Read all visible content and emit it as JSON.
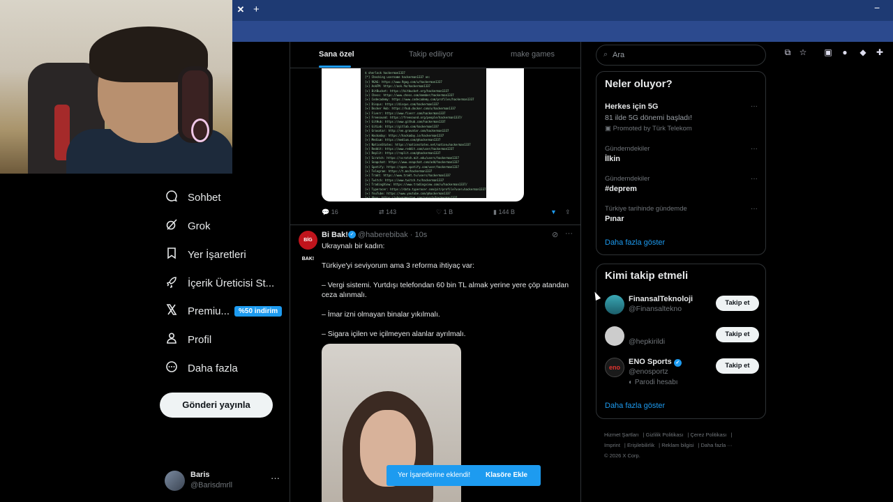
{
  "browser": {
    "close_tab": "✕",
    "new_tab": "+",
    "minimize": "−"
  },
  "sidebar": {
    "items": [
      {
        "label": "Sohbet",
        "icon": "chat-icon"
      },
      {
        "label": "Grok",
        "icon": "grok-icon"
      },
      {
        "label": "Yer İşaretleri",
        "icon": "bookmark-icon"
      },
      {
        "label": "İçerik Üreticisi St...",
        "icon": "rocket-icon"
      },
      {
        "label": "Premiu...",
        "icon": "x-logo-icon",
        "badge": "%50 indirim"
      },
      {
        "label": "Profil",
        "icon": "person-icon"
      },
      {
        "label": "Daha fazla",
        "icon": "more-circle-icon"
      }
    ],
    "post_button": "Gönderi yayınla",
    "account": {
      "name": "Baris",
      "handle": "@Barisdmrll"
    }
  },
  "feed": {
    "tabs": [
      "Sana özel",
      "Takip ediliyor",
      "make games"
    ],
    "prev_tweet_actions": {
      "replies": "16",
      "retweets": "143",
      "likes": "1 B",
      "views": "144 B"
    },
    "tweet": {
      "avatar_text": "BİG BAK!",
      "name": "Bi Bak!",
      "handle": "@haberebibak · 10s",
      "lines": [
        "Ukraynalı bir kadın:",
        "Türkiye'yi seviyorum ama 3 reforma ihtiyaç var:",
        "– Vergi sistemi. Yurtdışı telefondan 60 bin TL almak yerine yere çöp atandan ceza alınmalı.",
        "– İmar izni olmayan binalar yıkılmalı.",
        "– Sigara içilen ve içilmeyen alanlar ayrılmalı."
      ]
    }
  },
  "toast": {
    "message": "Yer İşaretlerine eklendi!",
    "action": "Klasöre Ekle"
  },
  "right": {
    "search_placeholder": "Ara",
    "trends_title": "Neler oluyor?",
    "trends": [
      {
        "context": "",
        "title": "Herkes için 5G",
        "sub": "81 ilde 5G dönemi başladı!",
        "promo": "Promoted by Türk Telekom"
      },
      {
        "context": "Gündemdekiler",
        "title": "İlkin"
      },
      {
        "context": "Gündemdekiler",
        "title": "#deprem"
      },
      {
        "context": "Türkiye tarihinde gündemde",
        "title": "Pınar"
      }
    ],
    "trends_more": "Daha fazla göster",
    "who_title": "Kimi takip etmeli",
    "who": [
      {
        "name": "FinansalTeknoloji",
        "handle": "@Finansaltekno",
        "extra": "",
        "button": "Takip et"
      },
      {
        "name": "",
        "handle": "@hepkirildi",
        "extra": "",
        "button": "Takip et"
      },
      {
        "name": "ENO Sports",
        "handle": "@enosportz",
        "extra": "Parodi hesabı",
        "button": "Takip et"
      }
    ],
    "who_more": "Daha fazla göster",
    "footer": [
      "Hizmet Şartları",
      "Gizlilik Politikası",
      "Çerez Politikası",
      "Imprint",
      "Erişilebilirlik",
      "Reklam bilgisi",
      "Daha fazla ···",
      "© 2026 X Corp."
    ]
  },
  "terminal_lines": [
    "$ sherlock hackerman1337",
    "[*] Checking username hackerman1337 on:",
    "[+] 9GAG: https://www.9gag.com/u/hackerman1337",
    "[+] AskFM: https://ask.fm/hackerman1337",
    "[+] BitBucket: https://bitbucket.org/hackerman1337",
    "[+] Chess: https://www.chess.com/member/hackerman1337",
    "[+] Codecademy: https://www.codecademy.com/profiles/hackerman1337",
    "[+] Disqus: https://disqus.com/hackerman1337",
    "[+] Docker Hub: https://hub.docker.com/u/hackerman1337",
    "[+] Fiverr: https://www.fiverr.com/hackerman1337",
    "[+] Freesound: https://freesound.org/people/hackerman1337/",
    "[+] GitHub: https://www.github.com/hackerman1337",
    "[+] GitLab: https://gitlab.com/hackerman1337",
    "[+] Gravatar: http://en.gravatar.com/hackerman1337",
    "[+] Hackaday: https://hackaday.io/hackerman1337",
    "[+] Medium: https://medium.com/@hackerman1337",
    "[+] NationStates: https://nationstates.net/nation=hackerman1337",
    "[+] Reddit: https://www.reddit.com/user/hackerman1337",
    "[+] Replit: https://replit.com/@hackerman1337",
    "[+] Scratch: https://scratch.mit.edu/users/hackerman1337",
    "[+] Snapchat: https://www.snapchat.com/add/hackerman1337",
    "[+] Spotify: https://open.spotify.com/user/hackerman1337",
    "[+] Telegram: https://t.me/hackerman1337",
    "[+] Trakt: https://www.trakt.tv/users/hackerman1337",
    "[+] Twitch: https://www.twitch.tv/hackerman1337",
    "[+] TradingView: https://www.tradingview.com/u/hackerman1337/",
    "[+] Typeracer: https://data.typeracer.com/pit/profile?user=hackerman1337",
    "[+] YouTube: https://www.youtube.com/@hackerman1337",
    "[+] Xbox: https://xboxgamertag.com/search/hackerman1337",
    "[+] eBay: https://www.ebay.com/usr/hackerman1337",
    "[+] lichess: https://lichess.org/@/hackerman1337",
    "[+] last.fm: https://last.fm/user/hackerman1337",
    "",
    "[*] Search completed with 39 results"
  ]
}
